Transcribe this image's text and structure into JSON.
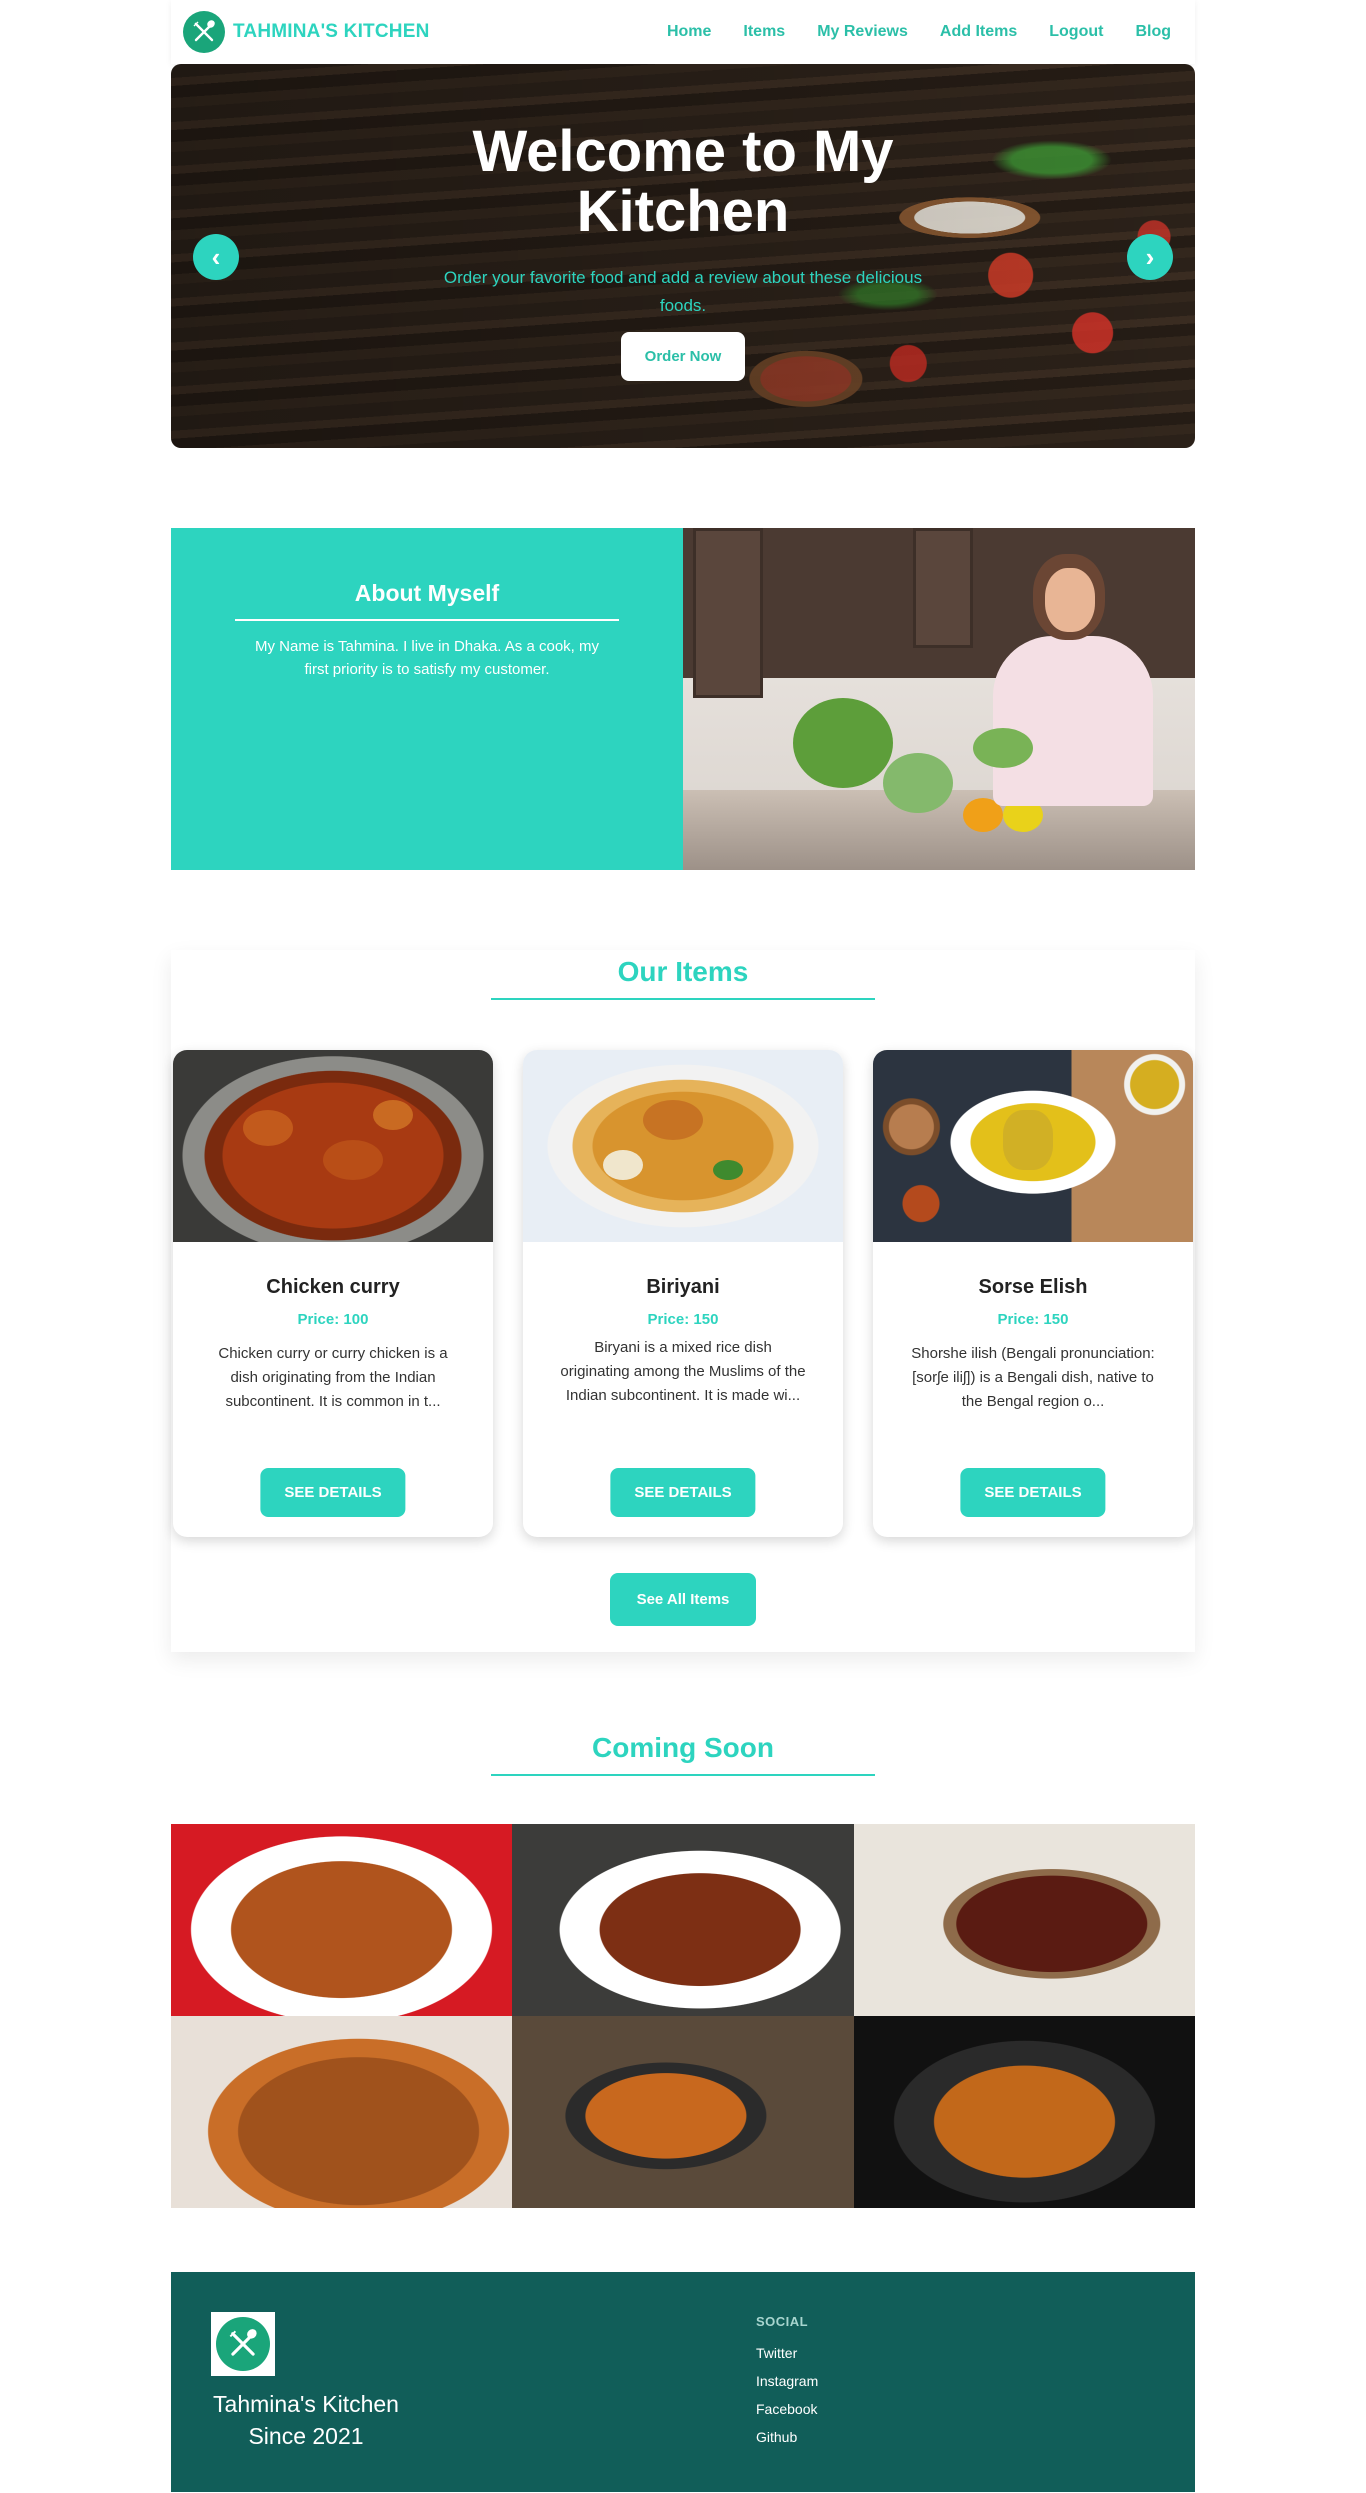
{
  "navbar": {
    "brand": "TAHMINA'S KITCHEN",
    "links": [
      "Home",
      "Items",
      "My Reviews",
      "Add Items",
      "Logout",
      "Blog"
    ]
  },
  "hero": {
    "title": "Welcome to My Kitchen",
    "subtitle": "Order your favorite food and add a review about these delicious foods.",
    "button": "Order Now",
    "prev_arrow": "‹",
    "next_arrow": "›"
  },
  "about": {
    "title": "About Myself",
    "text": "My Name is Tahmina. I live in Dhaka. As a cook, my first priority is to satisfy my customer."
  },
  "items_section": {
    "title": "Our Items",
    "cards": [
      {
        "name": "Chicken curry",
        "price": "Price: 100",
        "description": "Chicken curry or curry chicken is a dish originating from the Indian subcontinent. It is common in t...",
        "button": "SEE DETAILS"
      },
      {
        "name": "Biriyani",
        "price": "Price: 150",
        "description": "Biryani is a mixed rice dish originating among the Muslims of the Indian subcontinent. It is made wi...",
        "button": "SEE DETAILS"
      },
      {
        "name": "Sorse Elish",
        "price": "Price: 150",
        "description": "Shorshe ilish (Bengali pronunciation: [sorʃe iliʃ]) is a Bengali dish, native to the Bengal region o...",
        "button": "SEE DETAILS"
      }
    ],
    "see_all": "See All Items"
  },
  "coming_soon": {
    "title": "Coming Soon"
  },
  "footer": {
    "brand_line1": "Tahmina's Kitchen",
    "brand_line2": "Since 2021",
    "social_heading": "SOCIAL",
    "social_links": [
      "Twitter",
      "Instagram",
      "Facebook",
      "Github"
    ]
  },
  "colors": {
    "accent": "#2dd4bf",
    "footer_bg": "#115e59",
    "logo_green": "#1aa57a"
  }
}
